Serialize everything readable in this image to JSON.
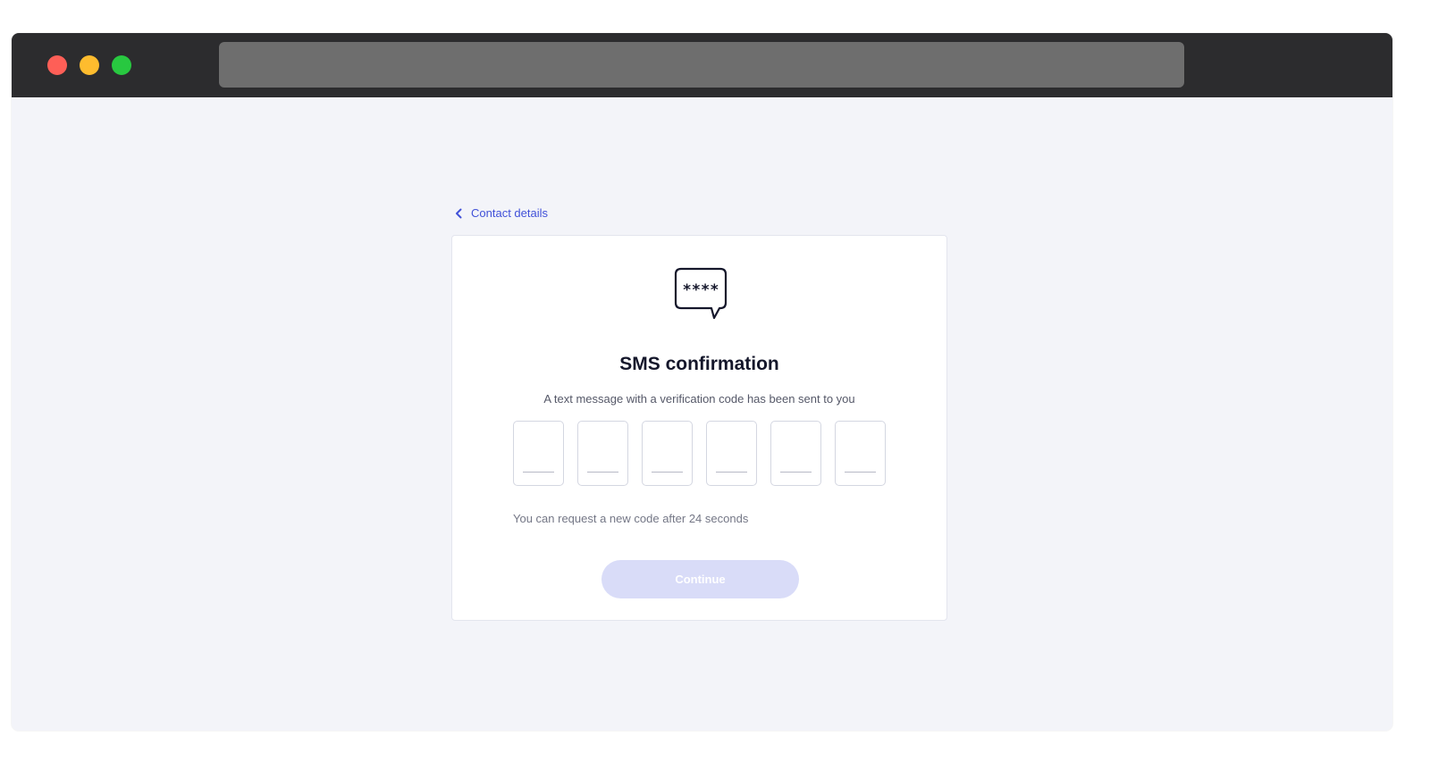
{
  "colors": {
    "accent": "#4151d8",
    "title": "#15172b",
    "button_disabled": "#d9dcf8",
    "background": "#f3f4f9"
  },
  "window": {
    "traffic_lights": [
      "close",
      "minimize",
      "zoom"
    ],
    "address_bar": ""
  },
  "nav": {
    "back_icon": "chevron-left-icon",
    "back_label": "Contact details"
  },
  "card": {
    "icon": "speech-bubble-asterisks-icon",
    "icon_text": "****",
    "title": "SMS confirmation",
    "subtitle": "A text message with a verification code has been sent to you",
    "code_digits": [
      "",
      "",
      "",
      "",
      "",
      ""
    ],
    "resend_text": "You can request a new code after 24 seconds",
    "continue_label": "Continue",
    "continue_disabled": true
  }
}
